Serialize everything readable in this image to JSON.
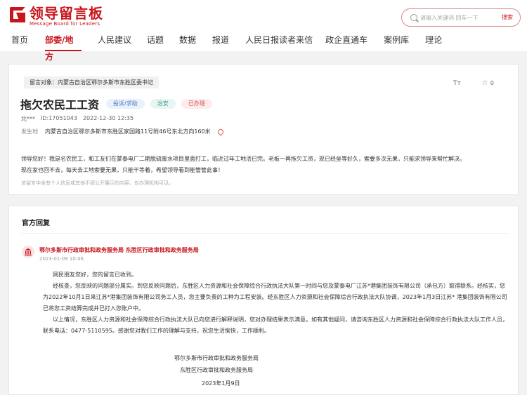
{
  "header": {
    "logo_title": "领导留言板",
    "logo_subtitle": "Message Board for Leaders",
    "search_placeholder": "请输入关键词 回车一下",
    "search_button": "搜索"
  },
  "nav": [
    {
      "label": "首页"
    },
    {
      "label": "部委/地方",
      "active": true
    },
    {
      "label": "人民建议"
    },
    {
      "label": "话题"
    },
    {
      "label": "数据"
    },
    {
      "label": "报道"
    },
    {
      "label": "人民日报读者来信"
    },
    {
      "label": "政企直通车"
    },
    {
      "label": "案例库"
    },
    {
      "label": "理论"
    }
  ],
  "message": {
    "to": "留言对象：内蒙古自治区鄂尔多斯市东胜区委书记",
    "title": "拖欠农民工工资",
    "tags": [
      "投诉/求助",
      "治安",
      "已办理"
    ],
    "author": "北***",
    "id": "ID:17051043",
    "datetime": "2022-12-30 12:35",
    "location_label": "发生地",
    "location": "内蒙古自治区鄂尔多斯市东胜区家园路11号附46号东北方向160米",
    "star_count": "0",
    "font_tool": "Tт",
    "content_line1": "领导您好！我是名农民工，和工友们在蒙泰电厂二期脱硫废水项目里面打工，临近过年工地活已完。老板一再拖欠工资，现已经坐等好久，索要多次无果，只能求领导来帮忙解决。",
    "content_line2": "现在家也回不去，每天去工地索要无果，只能干等着，希望领导看到能管管此事！",
    "disclaimer": "该留言中含有个人信息或其他不便公开展示的内容，仅办理机构可见。"
  },
  "reply": {
    "heading": "官方回复",
    "org": "鄂尔多斯市行政审批和政务服务局 东胜区行政审批和政务服务局",
    "time": "2023-01-09 10:46",
    "greeting": "网民朋友您好，您的留言已收到。",
    "p1": "经核查，您反映的问题部分属实。到您反映问题后，东胜区人力资源和社会保障综合行政执法大队第一时间与您及蒙泰电厂江苏*港集团装饰有限公司（承包方）取得联系。经核实，您为2022年10月1日来江苏*港集团装饰有限公司务工人员，您主要负责的工种为工程安装。经东胜区人力资源和社会保障综合行政执法大队协调，2023年1月3日江苏* 港集团装饰有限公司已将您工资结算完成并已打入您账户中。",
    "p2": "以上情况，东胜区人力资源和社会保障综合行政执法大队已向您进行解释说明，您对办理结果表示满意。如有其他疑问，请咨询东胜区人力资源和社会保障综合行政执法大队工作人员，联系电话：0477-5110595。感谢您对我们工作的理解与支持，祝您生活愉快，工作顺利。",
    "sign1": "鄂尔多斯市行政审批和政务服务局",
    "sign2": "东胜区行政审批和政务服务局",
    "sign3": "2023年1月9日"
  }
}
